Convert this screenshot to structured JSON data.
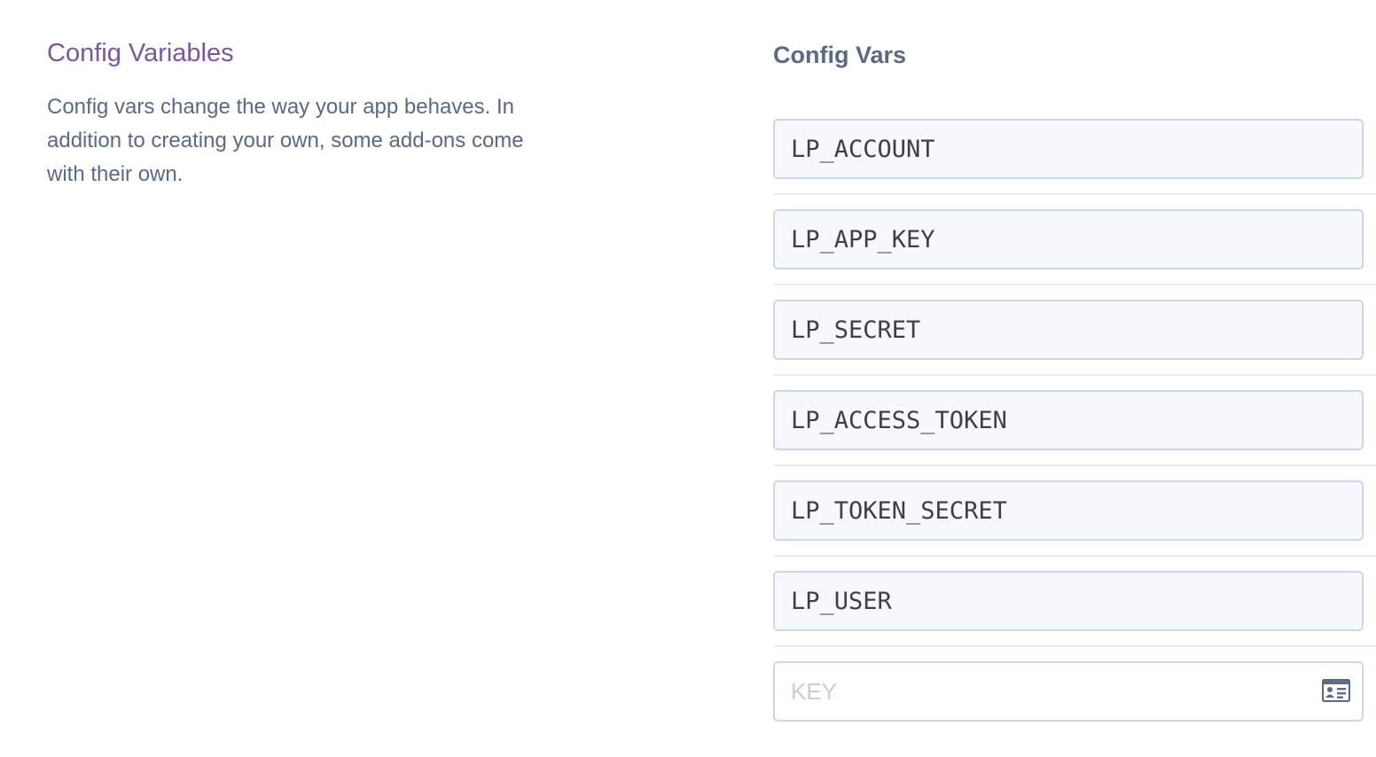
{
  "section": {
    "title": "Config Variables",
    "description": "Config vars change the way your app behaves. In addition to creating your own, some add-ons come with their own."
  },
  "config_vars": {
    "heading": "Config Vars",
    "keys": [
      "LP_ACCOUNT",
      "LP_APP_KEY",
      "LP_SECRET",
      "LP_ACCESS_TOKEN",
      "LP_TOKEN_SECRET",
      "LP_USER"
    ],
    "new_key": {
      "placeholder": "KEY",
      "icon": "id-card-icon"
    }
  },
  "colors": {
    "accent_purple": "#79589f",
    "text_slate": "#5a6a85",
    "input_border": "#cfd7e6",
    "input_bg": "#f7f8fb"
  }
}
